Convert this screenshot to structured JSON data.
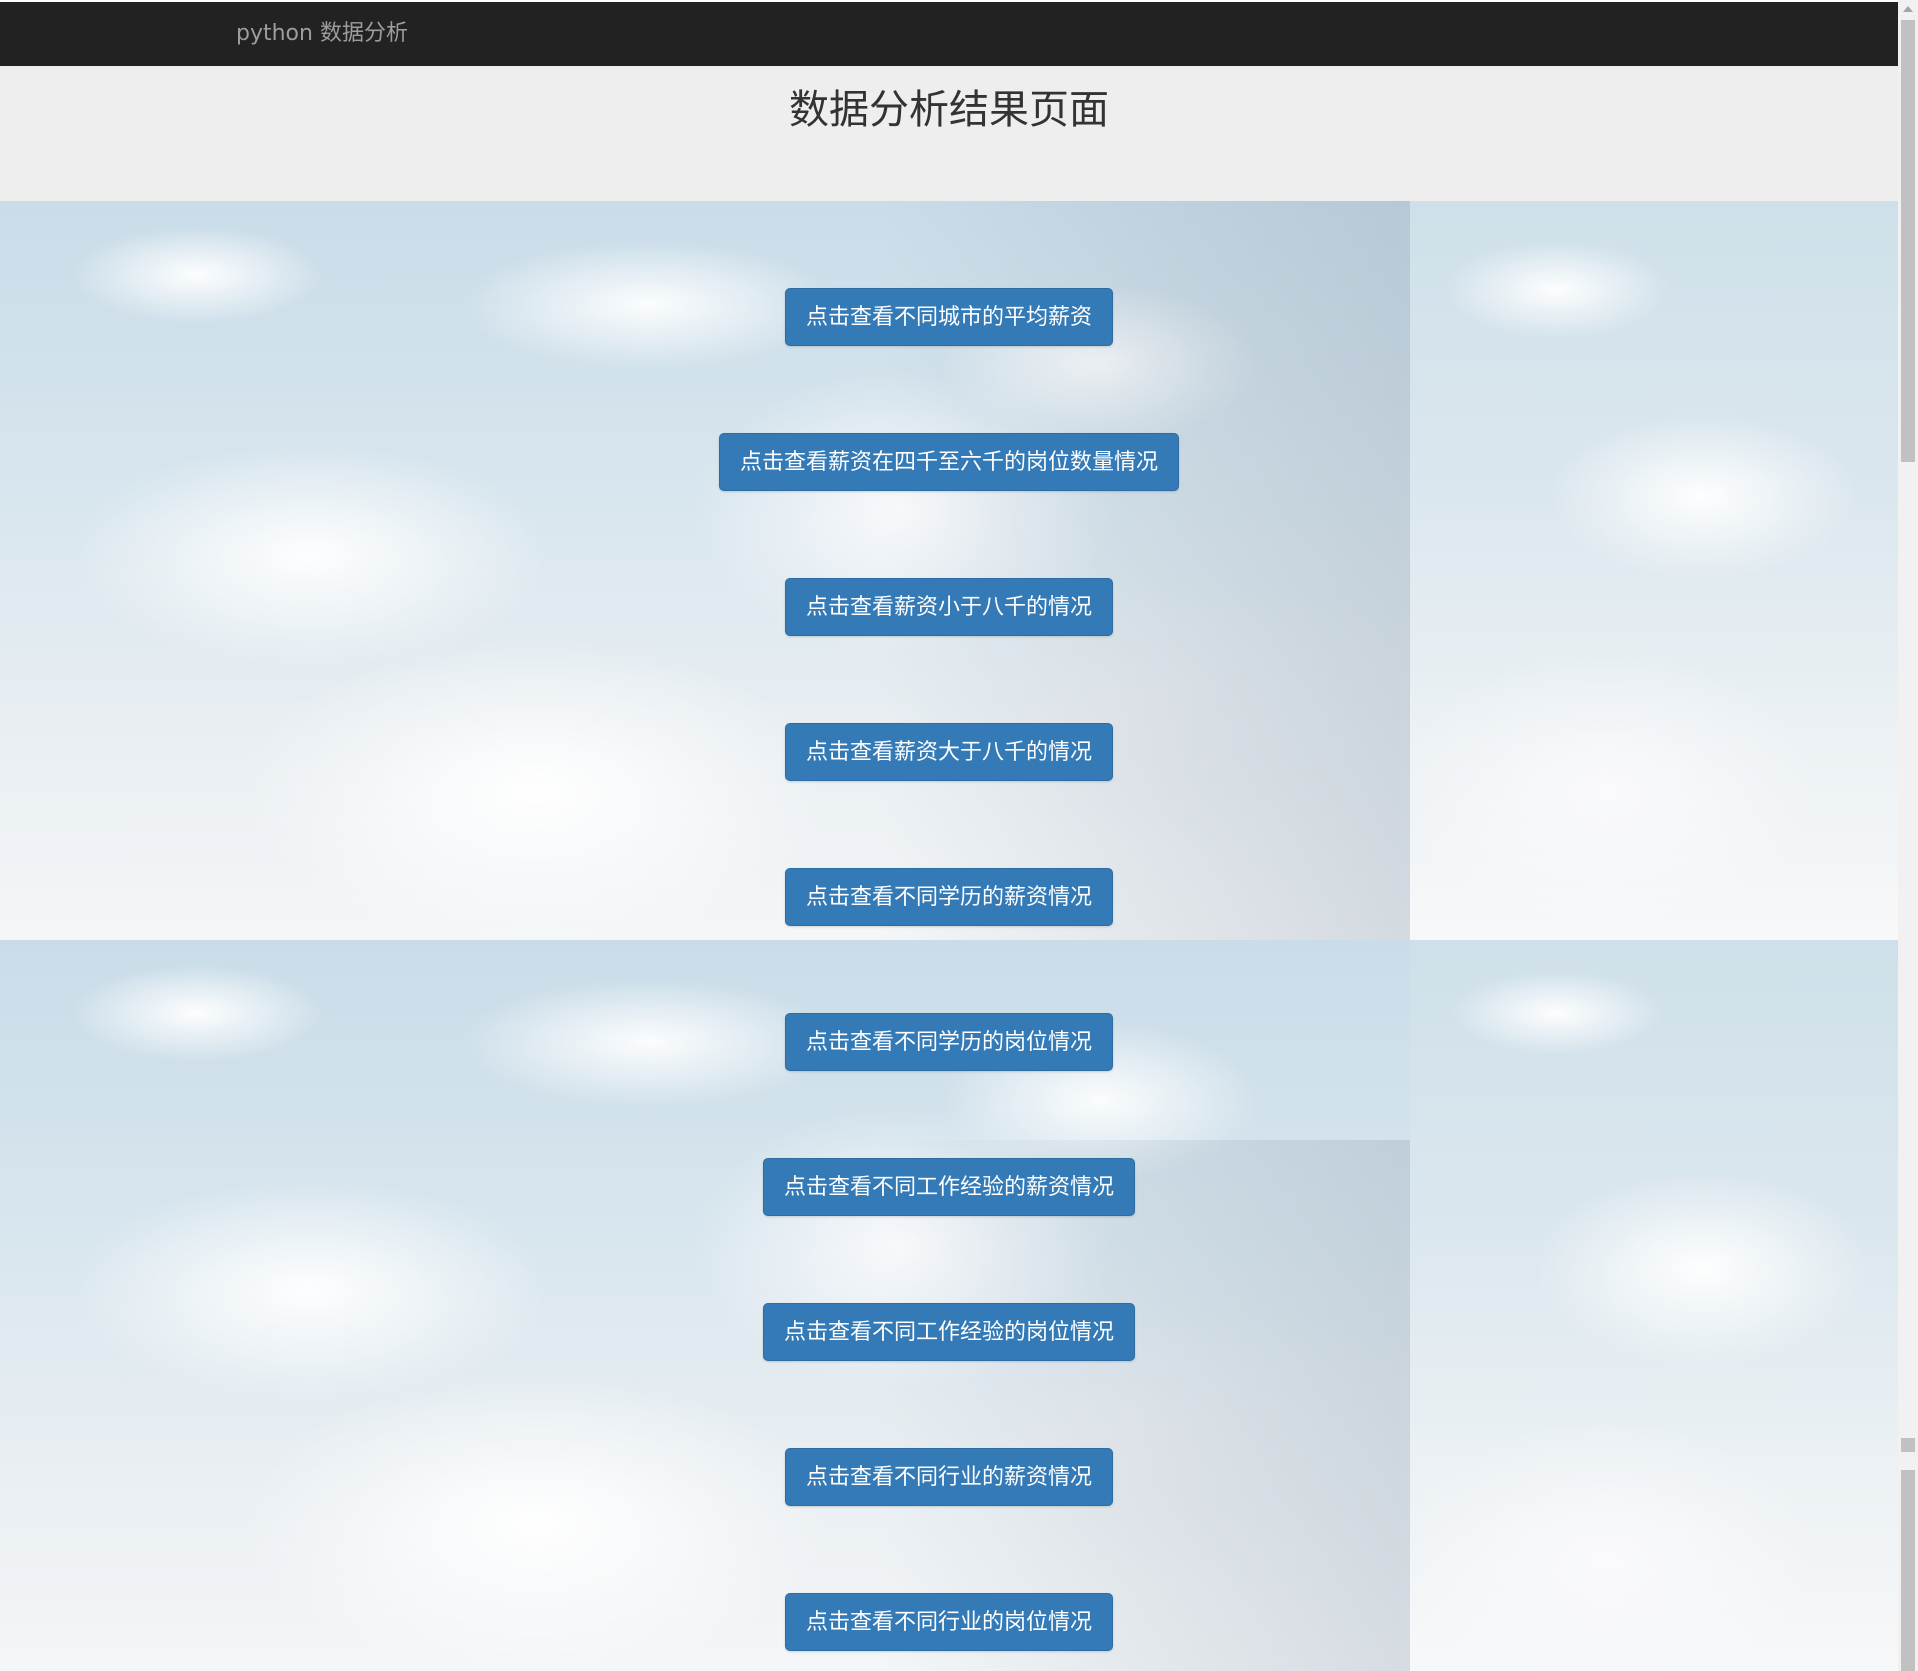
{
  "navbar": {
    "brand": "python 数据分析"
  },
  "header": {
    "title": "数据分析结果页面"
  },
  "buttons": [
    {
      "label": "点击查看不同城市的平均薪资"
    },
    {
      "label": "点击查看薪资在四千至六千的岗位数量情况"
    },
    {
      "label": "点击查看薪资小于八千的情况"
    },
    {
      "label": "点击查看薪资大于八千的情况"
    },
    {
      "label": "点击查看不同学历的薪资情况"
    },
    {
      "label": "点击查看不同学历的岗位情况"
    },
    {
      "label": "点击查看不同工作经验的薪资情况"
    },
    {
      "label": "点击查看不同工作经验的岗位情况"
    },
    {
      "label": "点击查看不同行业的薪资情况"
    },
    {
      "label": "点击查看不同行业的岗位情况"
    }
  ],
  "colors": {
    "navbar_bg": "#222222",
    "brand_text": "#9d9d9d",
    "button_bg": "#337ab7",
    "button_text": "#ffffff",
    "header_bg": "#eeeeee"
  }
}
